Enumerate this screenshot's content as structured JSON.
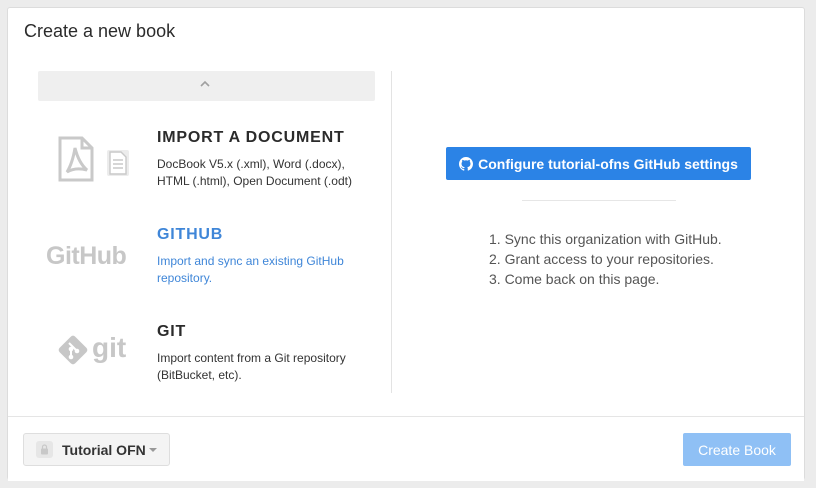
{
  "dialog": {
    "title": "Create a new book"
  },
  "sources": [
    {
      "name": "IMPORT A DOCUMENT",
      "description": "DocBook V5.x (.xml), Word (.docx), HTML (.html), Open Document (.odt)",
      "icon": "pdf-document-icon",
      "active": false
    },
    {
      "name": "GITHUB",
      "description": "Import and sync an existing GitHub repository.",
      "icon": "github-logo",
      "logo_text": "GitHub",
      "active": true
    },
    {
      "name": "GIT",
      "description": "Import content from a Git repository (BitBucket, etc).",
      "icon": "git-logo",
      "logo_text": "git",
      "active": false
    }
  ],
  "github_panel": {
    "configure_button_label": "Configure tutorial-ofns GitHub settings",
    "steps": [
      "1. Sync this organization with GitHub.",
      "2. Grant access to your repositories.",
      "3. Come back on this page."
    ]
  },
  "footer": {
    "organization_label": "Tutorial OFN",
    "create_button_label": "Create Book",
    "create_button_disabled": true
  },
  "colors": {
    "accent": "#2b83e6",
    "active_text": "#3f86d8",
    "disabled_button": "#8fc0f5"
  }
}
